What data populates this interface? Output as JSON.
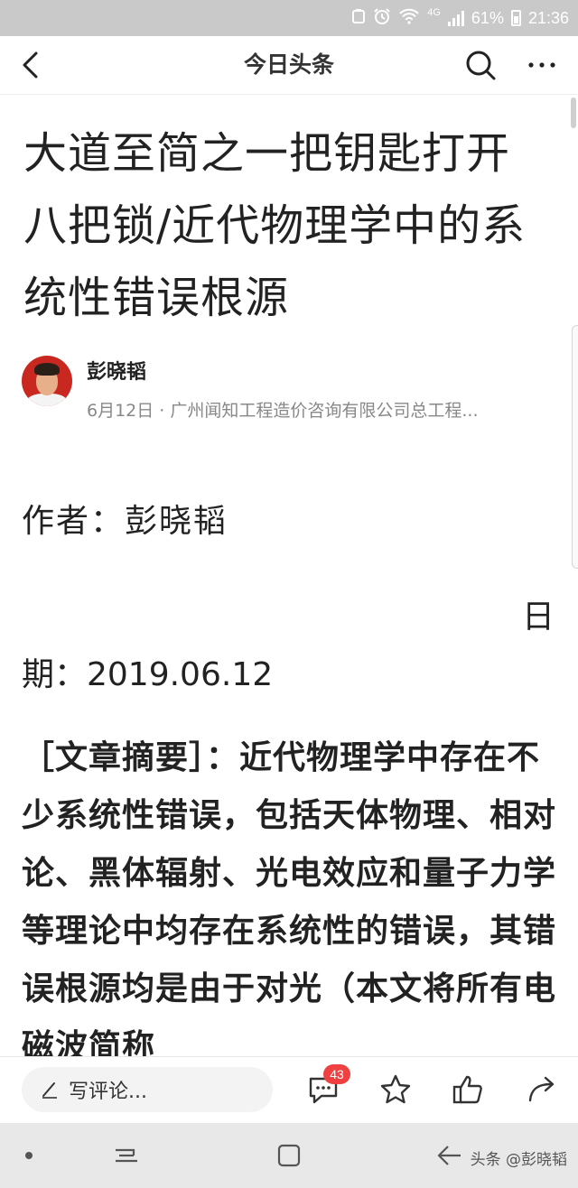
{
  "status_bar": {
    "network": "4G",
    "battery": "61%",
    "time": "21:36"
  },
  "header": {
    "title": "今日头条"
  },
  "article": {
    "title": "大道至简之一把钥匙打开八把锁/近代物理学中的系统性错误根源",
    "author_name": "彭晓韬",
    "meta": "6月12日 · 广州闻知工程造价咨询有限公司总工程...",
    "author_line": "作者：彭晓韬",
    "date_tail": "日",
    "date_line": "期：2019.06.12",
    "summary": "［文章摘要］：近代物理学中存在不少系统性错误，包括天体物理、相对论、黑体辐射、光电效应和量子力学等理论中均存在系统性的错误，其错误根源均是由于对光（本文将所有电磁波简称"
  },
  "action_bar": {
    "comment_placeholder": "写评论...",
    "comment_count": "43"
  },
  "watermark": "头条 @彭晓韬",
  "colors": {
    "status_bar_bg": "#c9c9c9",
    "badge": "#f04142",
    "nav_bar_bg": "#e8e8e8"
  },
  "icons": [
    "back-icon",
    "search-icon",
    "more-icon",
    "pen-icon",
    "comment-icon",
    "star-icon",
    "thumbs-up-icon",
    "share-icon"
  ]
}
